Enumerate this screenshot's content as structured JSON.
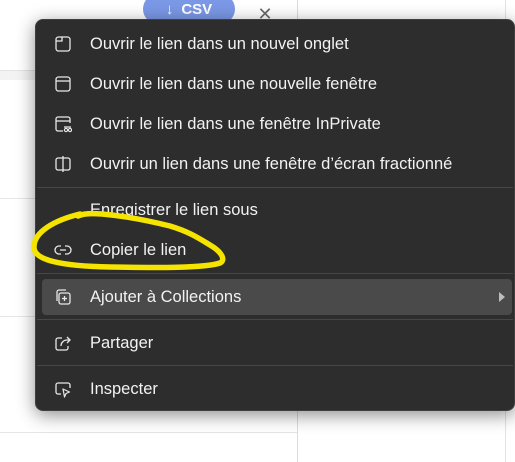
{
  "background": {
    "csv_button_label": "CSV",
    "csv_button_icon": "download-arrow-icon",
    "close_icon": "close-icon"
  },
  "context_menu": {
    "items": [
      {
        "label": "Ouvrir le lien dans un nouvel onglet",
        "icon": "new-tab-icon"
      },
      {
        "label": "Ouvrir le lien dans une nouvelle fenêtre",
        "icon": "new-window-icon"
      },
      {
        "label": "Ouvrir le lien dans une fenêtre InPrivate",
        "icon": "inprivate-window-icon"
      },
      {
        "label": "Ouvrir un lien dans une fenêtre d’écran fractionné",
        "icon": "split-screen-icon"
      },
      {
        "label": "Enregistrer le lien sous",
        "icon": ""
      },
      {
        "label": "Copier le lien",
        "icon": "link-icon"
      },
      {
        "label": "Ajouter à Collections",
        "icon": "collections-add-icon",
        "has_submenu": true,
        "highlighted": true
      },
      {
        "label": "Partager",
        "icon": "share-icon"
      },
      {
        "label": "Inspecter",
        "icon": "inspect-icon"
      }
    ]
  },
  "colors": {
    "menu_background": "#2d2d2d",
    "menu_highlight": "#4a4a4a",
    "menu_text": "#f2f2f2",
    "annotation_stroke": "#f5e400",
    "csv_button": "#7b98e6"
  }
}
